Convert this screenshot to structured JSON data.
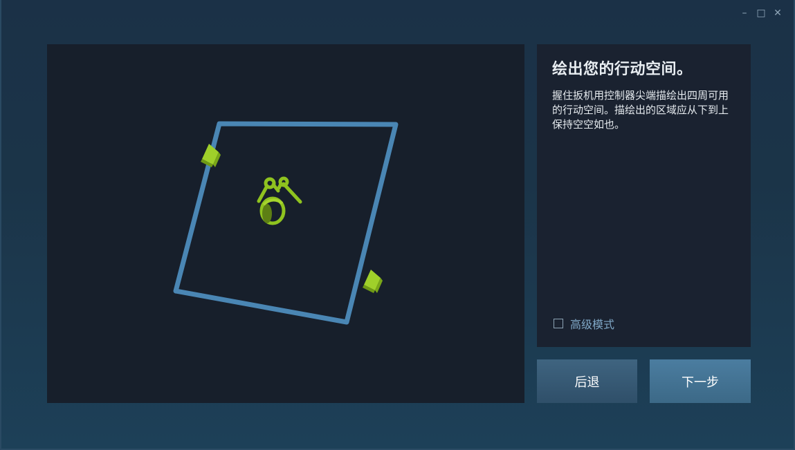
{
  "window": {
    "controls": {
      "minimize": "–",
      "maximize": "□",
      "close": "✕"
    }
  },
  "panel": {
    "title": "绘出您的行动空间。",
    "description": "握住扳机用控制器尖端描绘出四周可用的行动空间。描绘出的区域应从下到上保持空空如也。",
    "advanced_mode": {
      "label": "高级模式",
      "checked": false
    }
  },
  "buttons": {
    "back": "后退",
    "next": "下一步"
  },
  "colors": {
    "boundary": "#4a86b4",
    "tracked_devices": "#8fc31f",
    "viewport_bg": "#171f2b",
    "panel_bg": "#1a2230"
  },
  "scene": {
    "icons": [
      "play-area-boundary",
      "base-station-icon",
      "controller-icon",
      "headset-icon"
    ]
  }
}
